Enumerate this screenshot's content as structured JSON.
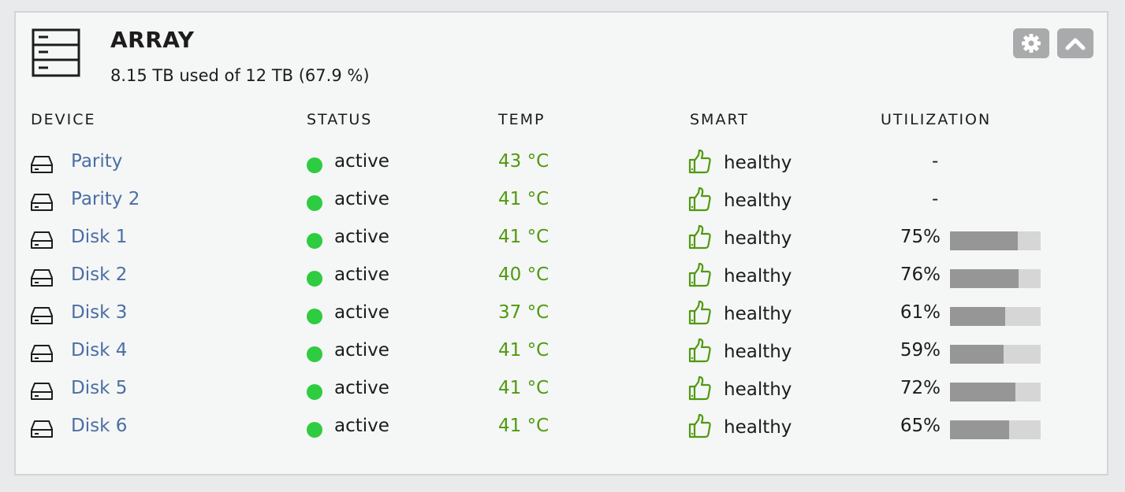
{
  "array": {
    "icon": "server-rack-icon",
    "title": "ARRAY",
    "usage": "8.15 TB used of 12 TB (67.9 %)",
    "settings_icon": "gear-icon",
    "collapse_icon": "chevron-up-icon"
  },
  "columns": {
    "device": "DEVICE",
    "status": "STATUS",
    "temp": "TEMP",
    "smart": "SMART",
    "utilization": "UTILIZATION"
  },
  "colors": {
    "link": "#4a6fa5",
    "status_active": "#2ecc40",
    "temp": "#4f9a0e",
    "bar_fill": "#969696",
    "bar_track": "#d6d6d6",
    "button": "#a9aaab"
  },
  "devices": [
    {
      "name": "Parity",
      "status": "active",
      "temp": "43 °C",
      "smart": "healthy",
      "utilization": "-",
      "util_value": null
    },
    {
      "name": "Parity 2",
      "status": "active",
      "temp": "41 °C",
      "smart": "healthy",
      "utilization": "-",
      "util_value": null
    },
    {
      "name": "Disk 1",
      "status": "active",
      "temp": "41 °C",
      "smart": "healthy",
      "utilization": "75%",
      "util_value": 75
    },
    {
      "name": "Disk 2",
      "status": "active",
      "temp": "40 °C",
      "smart": "healthy",
      "utilization": "76%",
      "util_value": 76
    },
    {
      "name": "Disk 3",
      "status": "active",
      "temp": "37 °C",
      "smart": "healthy",
      "utilization": "61%",
      "util_value": 61
    },
    {
      "name": "Disk 4",
      "status": "active",
      "temp": "41 °C",
      "smart": "healthy",
      "utilization": "59%",
      "util_value": 59
    },
    {
      "name": "Disk 5",
      "status": "active",
      "temp": "41 °C",
      "smart": "healthy",
      "utilization": "72%",
      "util_value": 72
    },
    {
      "name": "Disk 6",
      "status": "active",
      "temp": "41 °C",
      "smart": "healthy",
      "utilization": "65%",
      "util_value": 65
    }
  ]
}
